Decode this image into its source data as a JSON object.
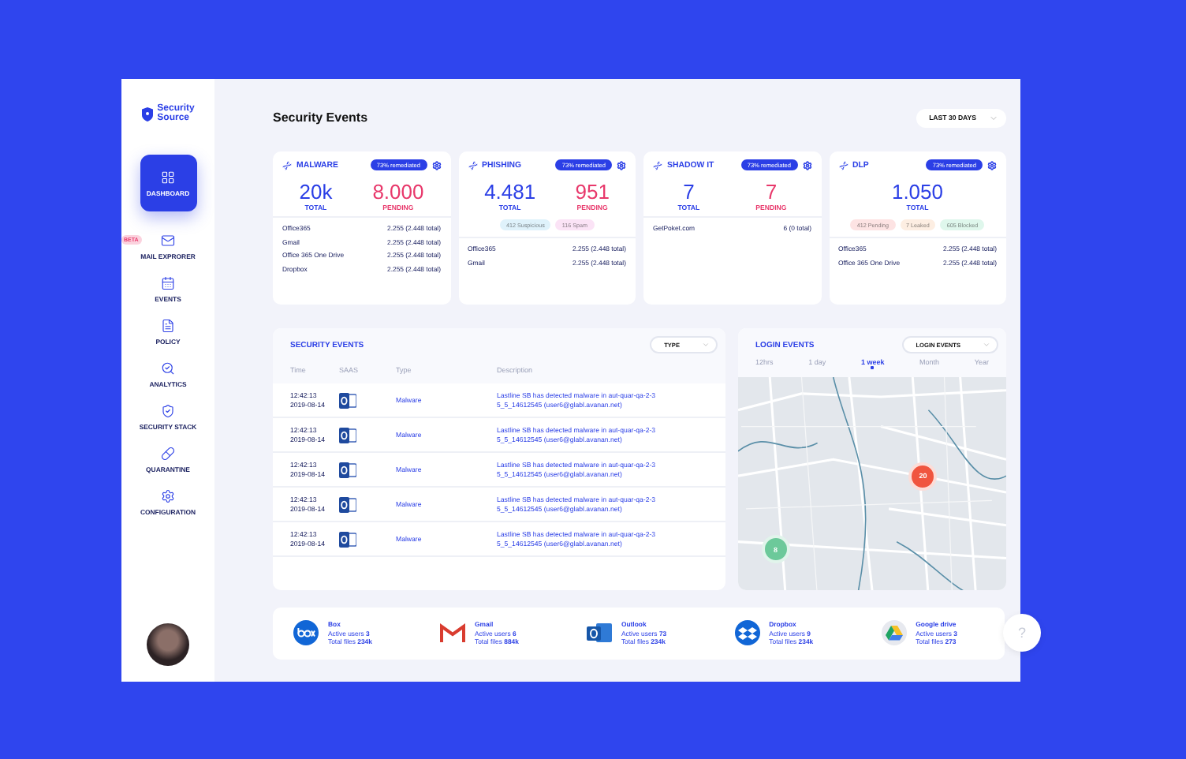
{
  "logo": {
    "line1": "Security",
    "line2": "Source"
  },
  "sidebar": [
    {
      "label": "DASHBOARD",
      "selected": true
    },
    {
      "label": "MAIL EXPRORER",
      "selected": false,
      "badge": "BETA"
    },
    {
      "label": "EVENTS",
      "selected": false
    },
    {
      "label": "POLICY",
      "selected": false
    },
    {
      "label": "ANALYTICS",
      "selected": false
    },
    {
      "label": "SECURITY STACK",
      "selected": false
    },
    {
      "label": "QUARANTINE",
      "selected": false
    },
    {
      "label": "CONFIGURATION",
      "selected": false
    }
  ],
  "page_title": "Security Events",
  "date_filter": "LAST 30 DAYS",
  "cards": [
    {
      "title": "MALWARE",
      "badge": "73% remediated",
      "stats": [
        {
          "value": "20k",
          "label": "TOTAL",
          "kind": "total"
        },
        {
          "value": "8.000",
          "label": "PENDING",
          "kind": "pending"
        }
      ],
      "rows": [
        {
          "name": "Office365",
          "value": "2.255 (2.448 total)"
        },
        {
          "name": "Gmail",
          "value": "2.255 (2.448 total)"
        },
        {
          "name": "Office 365 One Drive",
          "value": "2.255 (2.448 total)"
        },
        {
          "name": "Dropbox",
          "value": "2.255 (2.448 total)"
        }
      ]
    },
    {
      "title": "PHISHING",
      "badge": "73% remediated",
      "stats": [
        {
          "value": "4.481",
          "label": "TOTAL",
          "kind": "total"
        },
        {
          "value": "951",
          "label": "PENDING",
          "kind": "pending"
        }
      ],
      "tags": [
        {
          "label": "412 Suspicious",
          "color": "#dff2fb"
        },
        {
          "label": "116 Spam",
          "color": "#fbe3f6"
        }
      ],
      "rows": [
        {
          "name": "Office365",
          "value": "2.255 (2.448 total)"
        },
        {
          "name": "Gmail",
          "value": "2.255 (2.448 total)"
        }
      ]
    },
    {
      "title": "SHADOW IT",
      "badge": "73% remediated",
      "stats": [
        {
          "value": "7",
          "label": "TOTAL",
          "kind": "total"
        },
        {
          "value": "7",
          "label": "PENDING",
          "kind": "pending"
        }
      ],
      "rows": [
        {
          "name": "GetPoket.com",
          "value": "6 (0 total)"
        }
      ]
    },
    {
      "title": "DLP",
      "badge": "73% remediated",
      "stats": [
        {
          "value": "1.050",
          "label": "TOTAL",
          "kind": "total"
        }
      ],
      "tags": [
        {
          "label": "412 Pending",
          "color": "#fde3e3"
        },
        {
          "label": "7 Leaked",
          "color": "#fdeee2"
        },
        {
          "label": "605 Blocked",
          "color": "#dff7ec"
        }
      ],
      "rows": [
        {
          "name": "Office365",
          "value": "2.255 (2.448 total)"
        },
        {
          "name": "Office 365 One Drive",
          "value": "2.255 (2.448 total)"
        }
      ]
    }
  ],
  "events": {
    "title": "SECURITY EVENTS",
    "filter": "TYPE",
    "columns": [
      "Time",
      "SAAS",
      "Type",
      "Description"
    ],
    "rows": [
      {
        "time": "12:42:13",
        "date": "2019-08-14",
        "type": "Malware",
        "description": "Lastline SB has detected malware in aut-quar-qa-2-3 5_5_14612545 (user6@glabl.avanan.net)"
      },
      {
        "time": "12:42:13",
        "date": "2019-08-14",
        "type": "Malware",
        "description": "Lastline SB has detected malware in aut-quar-qa-2-3 5_5_14612545 (user6@glabl.avanan.net)"
      },
      {
        "time": "12:42:13",
        "date": "2019-08-14",
        "type": "Malware",
        "description": "Lastline SB has detected malware in aut-quar-qa-2-3 5_5_14612545 (user6@glabl.avanan.net)"
      },
      {
        "time": "12:42:13",
        "date": "2019-08-14",
        "type": "Malware",
        "description": "Lastline SB has detected malware in aut-quar-qa-2-3 5_5_14612545 (user6@glabl.avanan.net)"
      },
      {
        "time": "12:42:13",
        "date": "2019-08-14",
        "type": "Malware",
        "description": "Lastline SB has detected malware in aut-quar-qa-2-3 5_5_14612545 (user6@glabl.avanan.net)"
      }
    ]
  },
  "login": {
    "title": "LOGIN EVENTS",
    "filter": "LOGIN EVENTS",
    "ranges": [
      {
        "label": "12hrs",
        "selected": false
      },
      {
        "label": "1 day",
        "selected": false
      },
      {
        "label": "1 week",
        "selected": true
      },
      {
        "label": "Month",
        "selected": false
      },
      {
        "label": "Year",
        "selected": false
      }
    ],
    "markers": [
      {
        "count": "20",
        "color": "#f0553f"
      },
      {
        "count": "8",
        "color": "#6cc99a"
      }
    ]
  },
  "apps": [
    {
      "name": "Box",
      "users": "Active users **3**",
      "files": "Total files **234k**"
    },
    {
      "name": "Gmail",
      "users": "Active users **6**",
      "files": "Total files **884k**"
    },
    {
      "name": "Outlook",
      "users": "Active users **73**",
      "files": "Total files **234k**"
    },
    {
      "name": "Dropbox",
      "users": "Active users **9**",
      "files": "Total files **234k**"
    },
    {
      "name": "Google drive",
      "users": "Active users **3**",
      "files": "Total files **273**"
    }
  ],
  "help": "?"
}
